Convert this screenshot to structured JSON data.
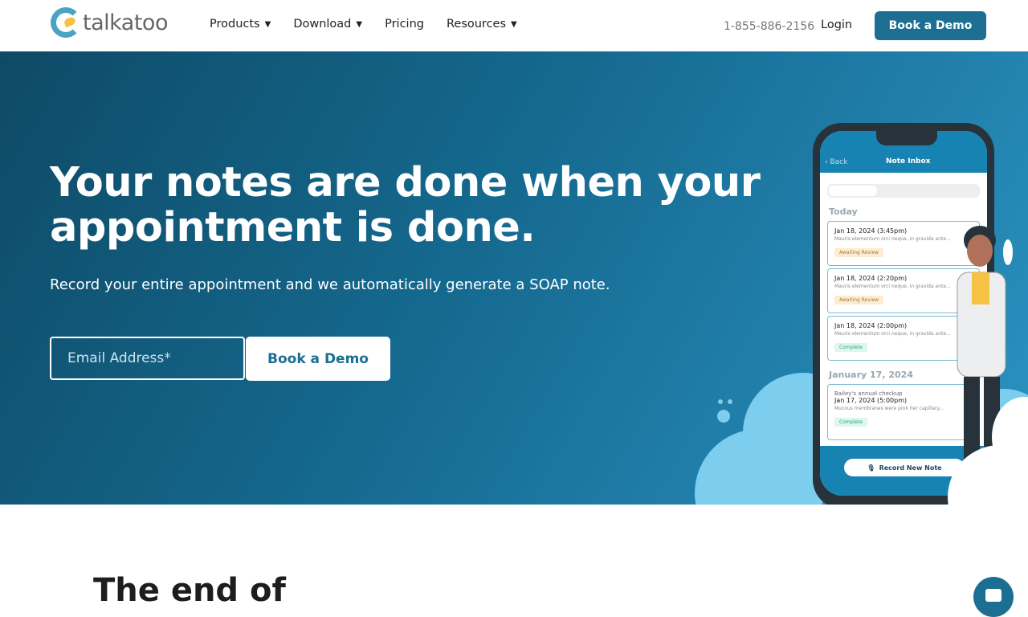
{
  "nav": {
    "logo_text": "talkatoo",
    "menu": [
      {
        "label": "Products",
        "dropdown": true
      },
      {
        "label": "Download",
        "dropdown": true
      },
      {
        "label": "Pricing",
        "dropdown": false
      },
      {
        "label": "Resources",
        "dropdown": true
      }
    ],
    "phone": "1-855-886-2156",
    "login": "Login",
    "demo": "Book a Demo"
  },
  "hero": {
    "title": "Your notes are done when your appointment is done.",
    "subtitle": "Record your entire appointment and we automatically generate a SOAP note.",
    "email_placeholder": "Email Address*",
    "demo": "Book a Demo"
  },
  "phone": {
    "back": "Back",
    "title": "Note Inbox",
    "today": "Today",
    "jan17": "January 17, 2024",
    "cards": [
      {
        "date": "Jan 18, 2024 (3:45pm)",
        "desc": "Mauris elementum orci neque, in gravida ante...",
        "status": "Awaiting Review"
      },
      {
        "date": "Jan 18, 2024 (2:20pm)",
        "desc": "Mauris elementum orci neque, in gravida ante...",
        "status": "Awaiting Review"
      },
      {
        "date": "Jan 18, 2024 (2:00pm)",
        "desc": "Mauris elementum orci neque, in gravida ante...",
        "status": "Complete"
      },
      {
        "kicker": "Bailey's annual checkup",
        "date": "Jan 17, 2024 (5:00pm)",
        "desc": "Mucous membranes were pink her capillary...",
        "status": "Complete"
      }
    ],
    "record": "Record New Note"
  },
  "section2": {
    "heading": "The end of"
  },
  "colors": {
    "brand": "#1c6f92",
    "cloud": "#7dcdef",
    "awaiting": "#fdeccf",
    "complete": "#ddf6ef"
  }
}
